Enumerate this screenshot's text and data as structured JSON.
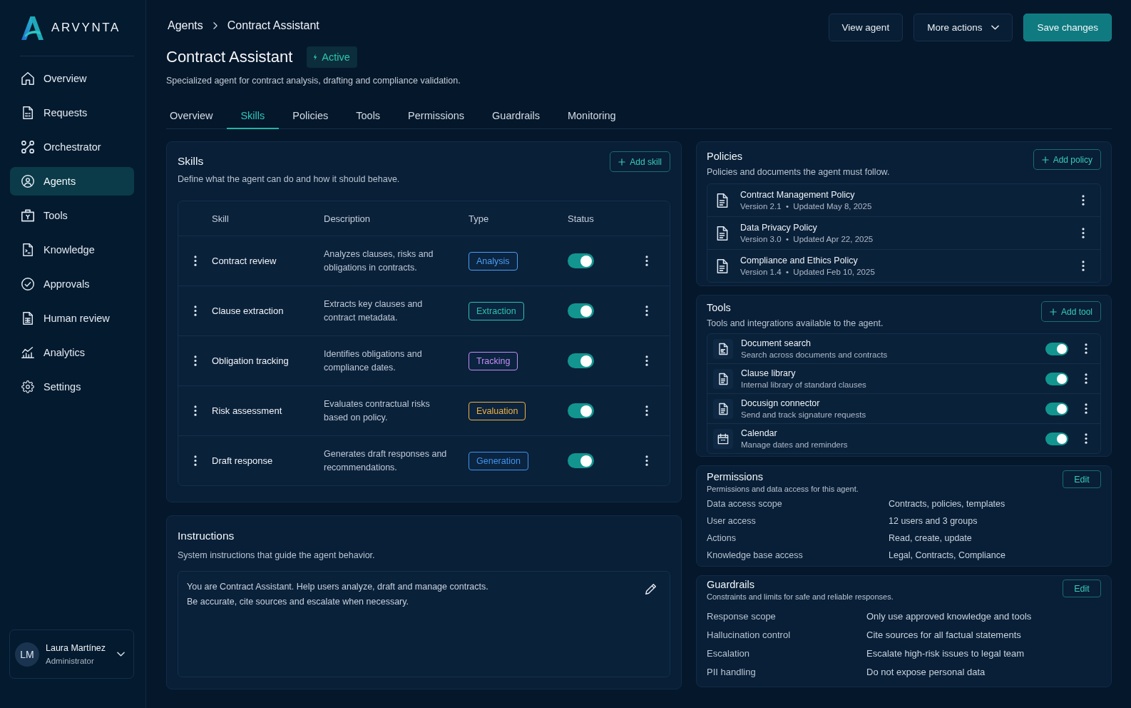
{
  "sidebar": {
    "logo": "ARVYNTA",
    "items": [
      {
        "label": "Overview",
        "selected": false
      },
      {
        "label": "Requests",
        "selected": false
      },
      {
        "label": "Orchestrator",
        "selected": false
      },
      {
        "label": "Agents",
        "selected": true
      },
      {
        "label": "Tools",
        "selected": false
      },
      {
        "label": "Knowledge",
        "selected": false
      },
      {
        "label": "Approvals",
        "selected": false
      },
      {
        "label": "Human review",
        "selected": false
      },
      {
        "label": "Analytics",
        "selected": false
      },
      {
        "label": "Settings",
        "selected": false
      }
    ],
    "user": {
      "initials": "LM",
      "name": "Laura Martínez",
      "role": "Administrator"
    }
  },
  "header": {
    "breadcrumb": [
      "Agents",
      "Contract Assistant"
    ],
    "title": "Contract Assistant",
    "status": "Active",
    "description": "Specialized agent for contract analysis, drafting and compliance validation.",
    "actions": [
      {
        "label": "View agent",
        "kind": "secondary"
      },
      {
        "label": "More actions",
        "kind": "menu"
      },
      {
        "label": "Save changes",
        "kind": "primary"
      }
    ]
  },
  "tabs": [
    {
      "label": "Overview",
      "selected": false
    },
    {
      "label": "Skills",
      "selected": true
    },
    {
      "label": "Policies",
      "selected": false
    },
    {
      "label": "Tools",
      "selected": false
    },
    {
      "label": "Permissions",
      "selected": false
    },
    {
      "label": "Guardrails",
      "selected": false
    },
    {
      "label": "Monitoring",
      "selected": false
    }
  ],
  "skills": {
    "title": "Skills",
    "subtitle": "Define what the agent can do and how it should behave.",
    "add_button": "Add skill",
    "columns": [
      "Skill",
      "Description",
      "Type",
      "Status"
    ],
    "rows": [
      {
        "name": "Contract review",
        "description": "Analyzes clauses, risks and obligations in contracts.",
        "type": "Analysis",
        "color": "#4a9ff5",
        "on": true
      },
      {
        "name": "Clause extraction",
        "description": "Extracts key clauses and contract metadata.",
        "type": "Extraction",
        "color": "#2cc4ad",
        "on": true
      },
      {
        "name": "Obligation tracking",
        "description": "Identifies obligations and compliance dates.",
        "type": "Tracking",
        "color": "#c58cf5",
        "on": true
      },
      {
        "name": "Risk assessment",
        "description": "Evaluates contractual risks based on policy.",
        "type": "Evaluation",
        "color": "#f2b23e",
        "on": true
      },
      {
        "name": "Draft response",
        "description": "Generates draft responses and recommendations.",
        "type": "Generation",
        "color": "#3f95ee",
        "on": true
      }
    ]
  },
  "instructions": {
    "title": "Instructions",
    "subtitle": "System instructions that guide the agent behavior.",
    "lines": [
      "You are Contract Assistant. Help users analyze, draft and manage contracts.",
      "Be accurate, cite sources and escalate when necessary."
    ]
  },
  "policies": {
    "title": "Policies",
    "subtitle": "Policies and documents the agent must follow.",
    "add_button": "Add policy",
    "items": [
      {
        "name": "Contract Management Policy",
        "meta": "Version 2.1  •  Updated May 8, 2025"
      },
      {
        "name": "Data Privacy Policy",
        "meta": "Version 3.0  •  Updated Apr 22, 2025"
      },
      {
        "name": "Compliance and Ethics Policy",
        "meta": "Version 1.4  •  Updated Feb 10, 2025"
      }
    ]
  },
  "tools": {
    "title": "Tools",
    "subtitle": "Tools and integrations available to the agent.",
    "add_button": "Add tool",
    "items": [
      {
        "name": "Document search",
        "description": "Search across documents and contracts",
        "on": true
      },
      {
        "name": "Clause library",
        "description": "Internal library of standard clauses",
        "on": true
      },
      {
        "name": "Docusign connector",
        "description": "Send and track signature requests",
        "on": true
      },
      {
        "name": "Calendar",
        "description": "Manage dates and reminders",
        "on": true
      }
    ]
  },
  "permissions": {
    "title": "Permissions",
    "subtitle": "Permissions and data access for this agent.",
    "edit_button": "Edit",
    "rows": [
      {
        "label": "Data access scope",
        "value": "Contracts, policies, templates"
      },
      {
        "label": "User access",
        "value": "12 users and 3 groups"
      },
      {
        "label": "Actions",
        "value": "Read, create, update"
      },
      {
        "label": "Knowledge base access",
        "value": "Legal, Contracts, Compliance"
      }
    ]
  },
  "guardrails": {
    "title": "Guardrails",
    "subtitle": "Constraints and limits for safe and reliable responses.",
    "edit_button": "Edit",
    "rows": [
      {
        "label": "Response scope",
        "value": "Only use approved knowledge and tools"
      },
      {
        "label": "Hallucination control",
        "value": "Cite sources for all factual statements"
      },
      {
        "label": "Escalation",
        "value": "Escalate high-risk issues to legal team"
      },
      {
        "label": "PII handling",
        "value": "Do not expose personal data"
      }
    ]
  }
}
